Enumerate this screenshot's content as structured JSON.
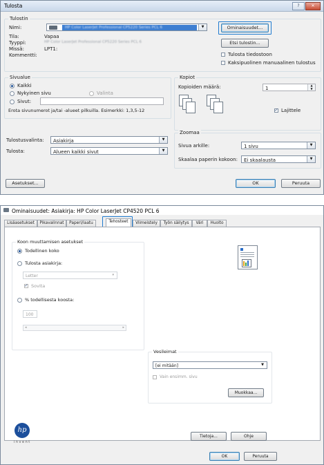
{
  "print_dialog": {
    "title": "Tulosta",
    "window_buttons": [
      "?",
      "✕"
    ],
    "printer_group": {
      "title": "Tulostin",
      "name_label": "Nimi:",
      "name_value": "HP Color LaserJet Professional CP5220 Series PCL 6",
      "status_label": "Tila:",
      "status_value": "Vapaa",
      "type_label": "Tyyppi:",
      "type_value": "HP Color LaserJet Professional CP5220 Series PCL 6",
      "where_label": "Missä:",
      "where_value": "LPT1:",
      "comment_label": "Kommentti:",
      "properties_button": "Ominaisuudet...",
      "find_printer_button": "Etsi tulostin...",
      "print_to_file": "Tulosta tiedostoon",
      "manual_duplex": "Kaksipuolinen manuaalinen tulostus"
    },
    "page_range": {
      "title": "Sivualue",
      "all": "Kaikki",
      "current_page": "Nykyinen sivu",
      "selection": "Valinta",
      "pages": "Sivut:",
      "hint": "Erota sivunumerot ja/tai -alueet pilkuilla. Esimerkki: 1,3,5-12"
    },
    "copies": {
      "title": "Kopiot",
      "count_label": "Kopioiden määrä:",
      "count_value": "1",
      "collate": "Lajittele"
    },
    "print_what_label": "Tulostusvalinta:",
    "print_what_value": "Asiakirja",
    "print_label": "Tulosta:",
    "print_value": "Alueen kaikki sivut",
    "zoom": {
      "title": "Zoomaa",
      "pages_per_sheet_label": "Sivua arkille:",
      "pages_per_sheet_value": "1 sivu",
      "scale_label": "Skaalaa paperin kokoon:",
      "scale_value": "Ei skaalausta"
    },
    "options_button": "Asetukset...",
    "ok_button": "OK",
    "cancel_button": "Peruuta"
  },
  "props_dialog": {
    "title": "Ominaisuudet: Asiakirja: HP Color LaserJet CP4520 PCL 6",
    "tabs": [
      "Lisäasetukset",
      "Pikavalinnat",
      "Paperi/laatu",
      "Tehosteet",
      "Viimeistely",
      "Työn säilytys",
      "Väri",
      "Huolto"
    ],
    "active_tab_index": 3,
    "resize_group": {
      "title": "Koon muuttamisen asetukset",
      "actual_size": "Todellinen koko",
      "print_document_on": "Tulosta asiakirja:",
      "paper_value": "Letter",
      "fit": "Sovita",
      "percent_of_actual": "% todellisesta koosta:",
      "percent_value": "100",
      "scroll_left": "◂",
      "scroll_right": "▸"
    },
    "watermarks": {
      "title": "Vesileimat",
      "value": "[ei mitään]",
      "first_page_only": "Vain ensimm. sivu",
      "edit_button": "Muokkaa..."
    },
    "logo_text": "invent",
    "about_button": "Tietoja...",
    "help_button": "Ohje",
    "ok_button": "OK",
    "cancel_button": "Peruuta"
  },
  "colors": {
    "highlight": "#1f7bd0",
    "window_bg": "#f0f0f0",
    "hp_blue": "#1c4f9c"
  }
}
